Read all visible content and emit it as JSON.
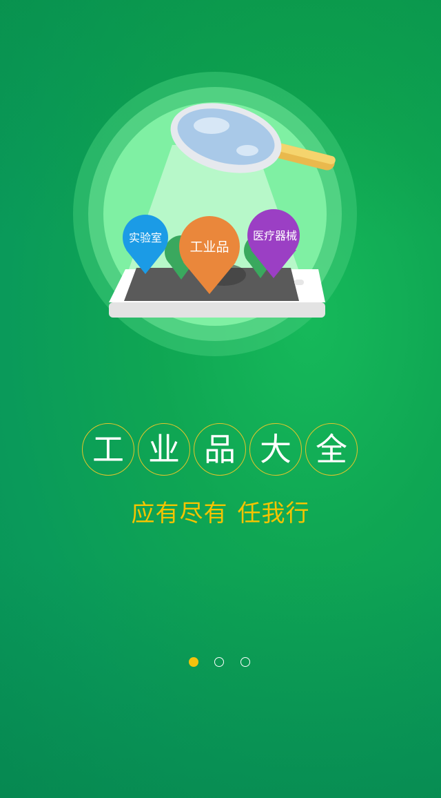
{
  "illustration": {
    "pins": [
      {
        "label": "实验室",
        "color": "#1b9be6"
      },
      {
        "label": "工业品",
        "color": "#ea873b"
      },
      {
        "label": "医疗器械",
        "color": "#9b3fc4"
      }
    ]
  },
  "title": {
    "chars": [
      "工",
      "业",
      "品",
      "大",
      "全"
    ]
  },
  "slogan": {
    "part1": "应有尽有",
    "part2": "任我行"
  },
  "pager": {
    "total": 3,
    "active_index": 0
  },
  "colors": {
    "background": "#12a853",
    "accent": "#f4c20d",
    "text": "#ffffff"
  }
}
